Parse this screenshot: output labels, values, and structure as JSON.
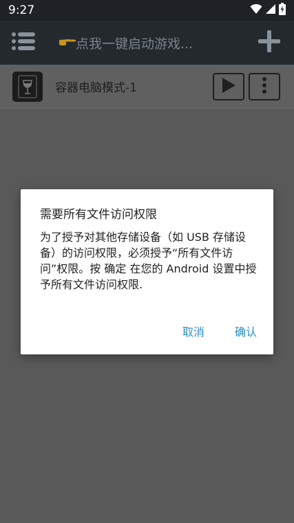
{
  "status_bar": {
    "time": "9:27"
  },
  "app_bar": {
    "title": "点我一键启动游戏..."
  },
  "containers": [
    {
      "name": "容器电脑模式-1"
    }
  ],
  "dialog": {
    "title": "需要所有文件访问权限",
    "message": "为了授予对其他存储设备（如 USB 存储设备）的访问权限，必须授予“所有文件访问”权限。按 确定 在您的 Android 设置中授予所有文件访问权限.",
    "cancel_label": "取消",
    "confirm_label": "确认"
  },
  "colors": {
    "accent": "#2b8fc5",
    "app_bar": "#24292e",
    "status_bar": "#1e2226",
    "scrim": "#5e5e5e"
  },
  "icons": {
    "menu": "list-menu-icon",
    "pointing_hand": "pointing-hand-icon",
    "add": "plus-icon",
    "wine": "wine-glass-icon",
    "play": "play-icon",
    "more": "more-vert-icon",
    "wifi": "wifi-icon",
    "signal": "signal-icon",
    "battery": "battery-charging-icon"
  }
}
